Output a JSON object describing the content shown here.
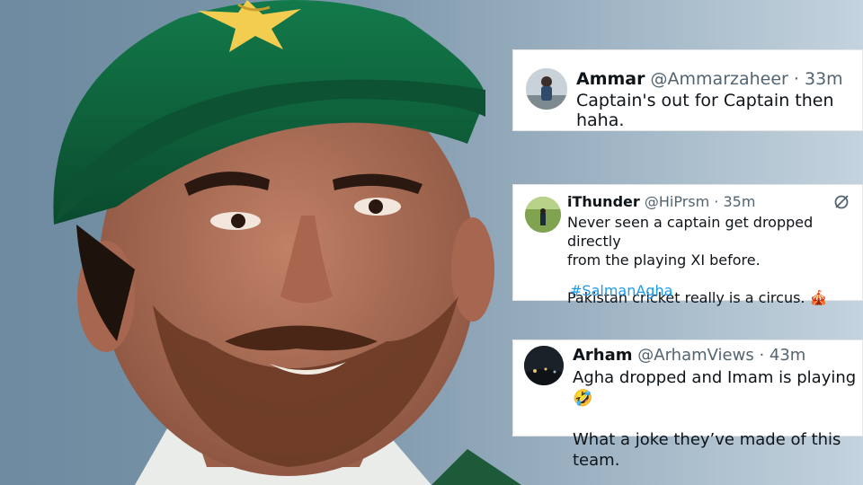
{
  "tweets": [
    {
      "name": "Ammar",
      "handle": "@Ammarzaheer · 33m",
      "text": "Captain's out for Captain then haha."
    },
    {
      "name": "iThunder",
      "handle": "@HiPrsm · 35m",
      "text": "Never seen a captain get dropped directly\nfrom the playing XI before.\n\nPakistan cricket really is a circus. 🎪",
      "hashtag": "#SalmanAgha"
    },
    {
      "name": "Arham",
      "handle": "@ArhamViews · 43m",
      "text": "Agha dropped and Imam is playing 🤣\n\nWhat a joke they’ve made of this team."
    }
  ],
  "colors": {
    "link": "#1d9bf0",
    "cap_green": "#0f5a3a",
    "star_gold": "#f3cd4f"
  },
  "icons": [
    "grok-icon"
  ]
}
